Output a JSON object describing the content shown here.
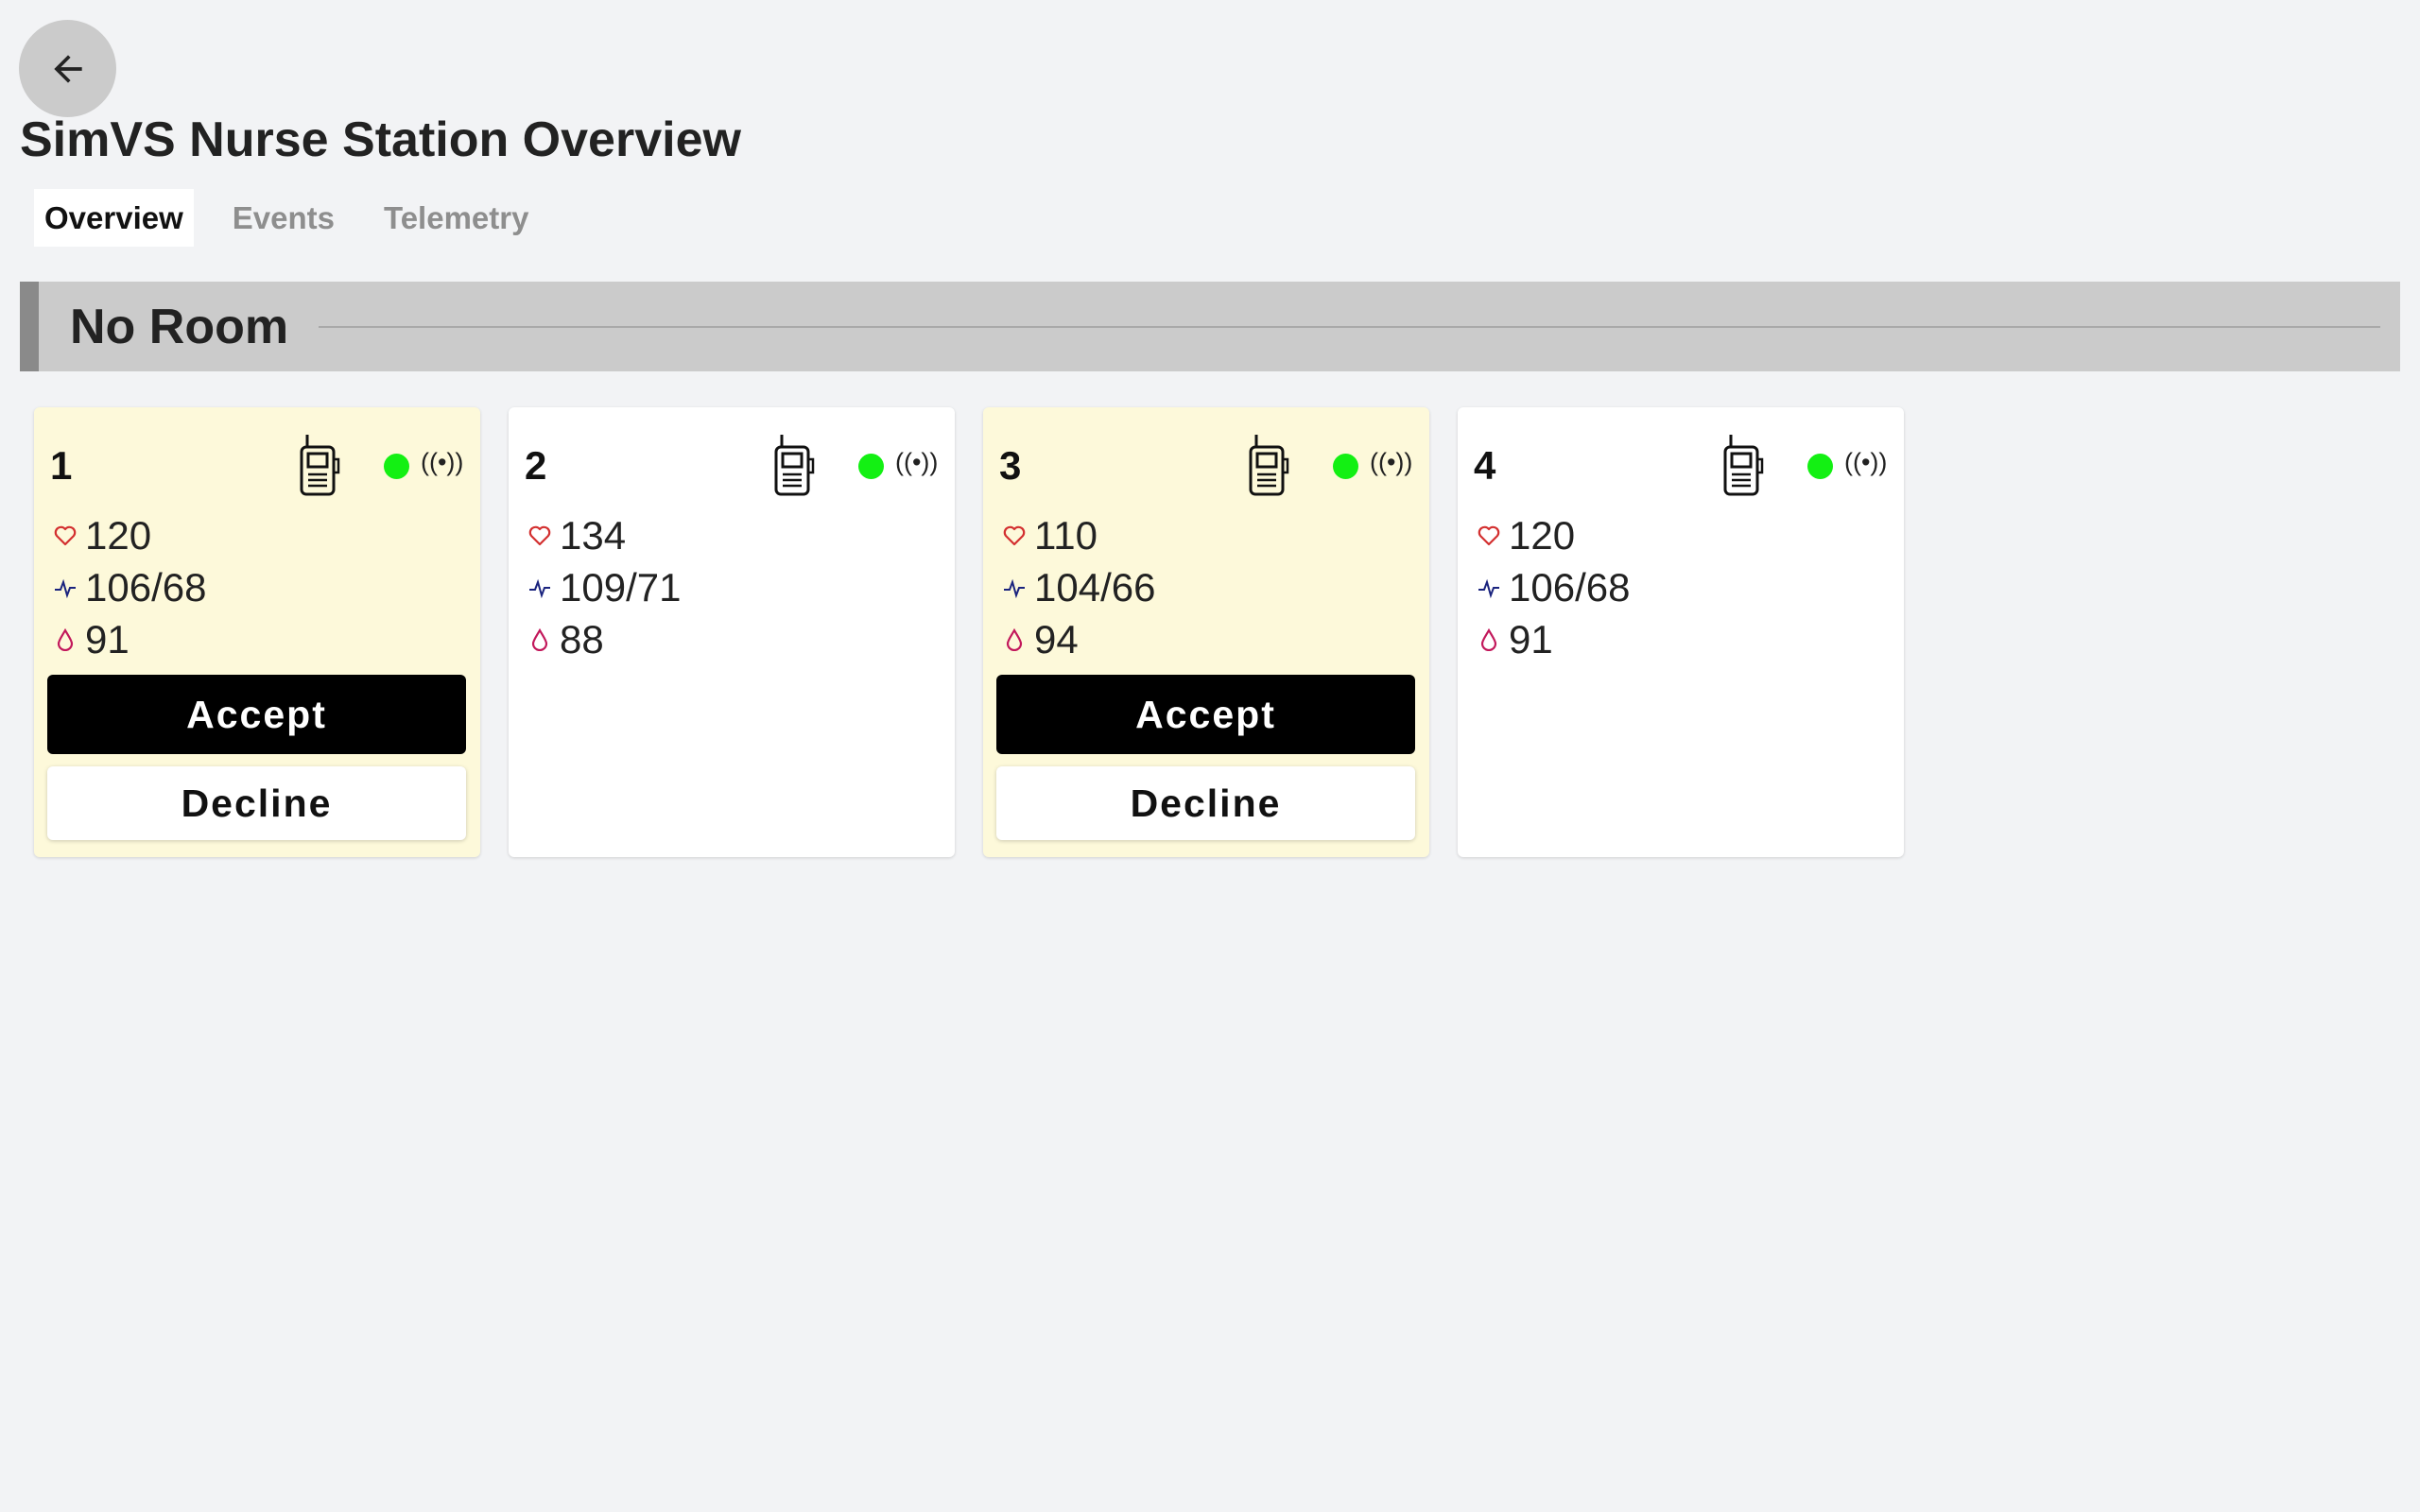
{
  "header": {
    "back_icon": "arrow-left-icon",
    "title": "SimVS Nurse Station Overview"
  },
  "tabs": [
    {
      "label": "Overview",
      "active": true
    },
    {
      "label": "Events",
      "active": false
    },
    {
      "label": "Telemetry",
      "active": false
    }
  ],
  "room": {
    "name": "No Room"
  },
  "colors": {
    "alert_card_bg": "#fdf9da",
    "status_online": "#13f013",
    "heart": "#d32f2f",
    "bp": "#1a237e",
    "spo2": "#c2185b"
  },
  "patients": [
    {
      "id": "1",
      "hr": "120",
      "bp": "106/68",
      "spo2": "91",
      "alert": true,
      "accept_label": "Accept",
      "decline_label": "Decline"
    },
    {
      "id": "2",
      "hr": "134",
      "bp": "109/71",
      "spo2": "88",
      "alert": false
    },
    {
      "id": "3",
      "hr": "110",
      "bp": "104/66",
      "spo2": "94",
      "alert": true,
      "accept_label": "Accept",
      "decline_label": "Decline"
    },
    {
      "id": "4",
      "hr": "120",
      "bp": "106/68",
      "spo2": "91",
      "alert": false
    }
  ],
  "icons": {
    "device": "walkie-talkie-icon",
    "status": "status-dot-icon",
    "signal": "signal-broadcast-icon",
    "signal_glyph": "((•))",
    "heart": "heart-icon",
    "bp": "pulse-icon",
    "spo2": "drop-icon"
  }
}
